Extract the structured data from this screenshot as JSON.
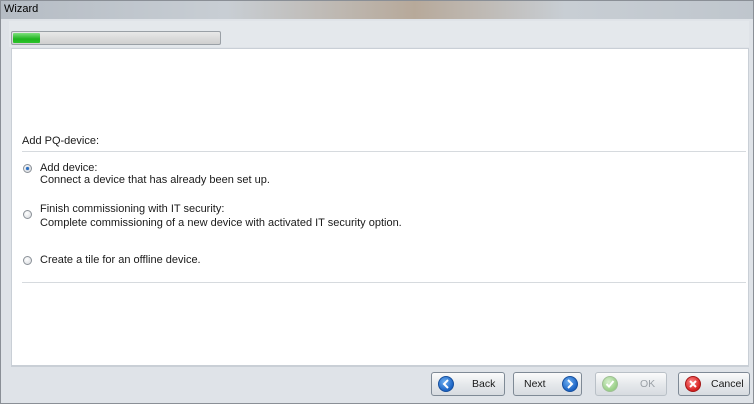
{
  "window": {
    "title": "Wizard"
  },
  "progress": {
    "value_percent": 13
  },
  "group": {
    "title": "Add PQ-device:"
  },
  "options": [
    {
      "title": "Add device:",
      "description": "Connect a device that has already been set up.",
      "selected": true
    },
    {
      "title": "Finish commissioning with IT security:",
      "description": "Complete commissioning of a new device with activated IT security option.",
      "selected": false
    },
    {
      "title": "Create a tile for an offline device.",
      "description": "",
      "selected": false
    }
  ],
  "buttons": {
    "back": "Back",
    "next": "Next",
    "ok": "OK",
    "cancel": "Cancel"
  },
  "icons": {
    "back": "arrow-left-icon",
    "next": "arrow-right-icon",
    "ok": "checkmark-icon",
    "cancel": "x-icon"
  }
}
